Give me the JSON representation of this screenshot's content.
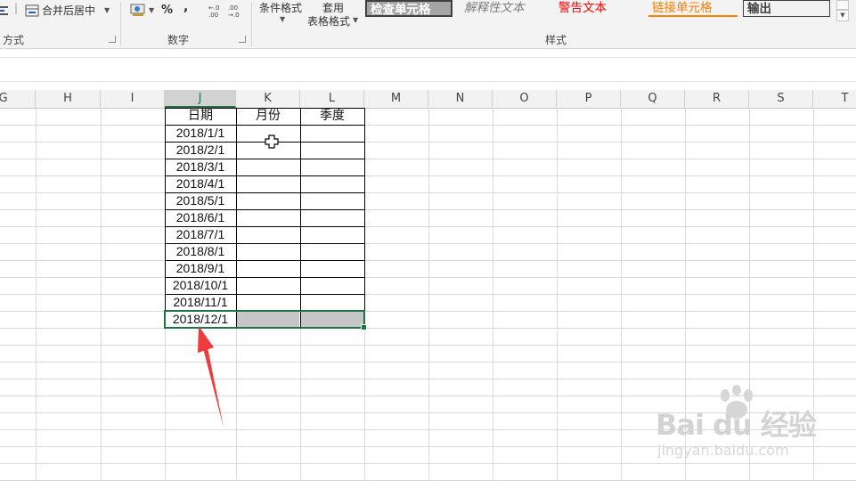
{
  "ribbon": {
    "alignment": {
      "merge_center_label": "合并后居中",
      "group_label_partial": "方式"
    },
    "number": {
      "percent_label": "%",
      "comma_label": ",",
      "increase_decimal_label": "←.0 .00",
      "decrease_decimal_label": ".00 →.0",
      "group_label": "数字"
    },
    "styles": {
      "conditional_format_label": "条件格式",
      "format_as_table_line1": "套用",
      "format_as_table_line2": "表格格式",
      "cell_styles": [
        "检查单元格",
        "解释性文本",
        "警告文本",
        "链接单元格",
        "输出"
      ],
      "group_label": "样式"
    }
  },
  "columns": [
    "G",
    "H",
    "I",
    "J",
    "K",
    "L",
    "M",
    "N",
    "O",
    "P",
    "Q",
    "R",
    "S",
    "T"
  ],
  "active_column": "J",
  "table": {
    "headers": [
      "日期",
      "月份",
      "季度"
    ],
    "dates": [
      "2018/1/1",
      "2018/2/1",
      "2018/3/1",
      "2018/4/1",
      "2018/5/1",
      "2018/6/1",
      "2018/7/1",
      "2018/8/1",
      "2018/9/1",
      "2018/10/1",
      "2018/11/1",
      "2018/12/1"
    ]
  },
  "watermark": {
    "brand": "Bai du 经验",
    "url": "jingyan.baidu.com"
  },
  "colors": {
    "excel_green": "#217346",
    "arrow_red": "#ee3b3b",
    "warning_red": "#ff0000",
    "linked_orange": "#fa7d00"
  }
}
